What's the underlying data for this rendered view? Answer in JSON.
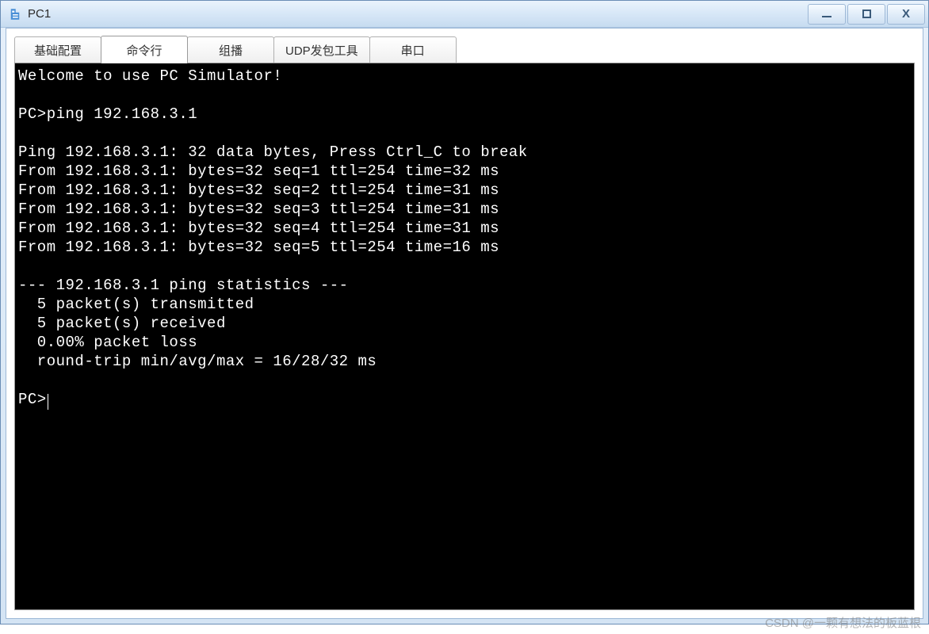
{
  "window": {
    "title": "PC1"
  },
  "tabs": [
    {
      "label": "基础配置",
      "active": false
    },
    {
      "label": "命令行",
      "active": true
    },
    {
      "label": "组播",
      "active": false
    },
    {
      "label": "UDP发包工具",
      "active": false
    },
    {
      "label": "串口",
      "active": false
    }
  ],
  "terminal": {
    "lines": [
      "Welcome to use PC Simulator!",
      "",
      "PC>ping 192.168.3.1",
      "",
      "Ping 192.168.3.1: 32 data bytes, Press Ctrl_C to break",
      "From 192.168.3.1: bytes=32 seq=1 ttl=254 time=32 ms",
      "From 192.168.3.1: bytes=32 seq=2 ttl=254 time=31 ms",
      "From 192.168.3.1: bytes=32 seq=3 ttl=254 time=31 ms",
      "From 192.168.3.1: bytes=32 seq=4 ttl=254 time=31 ms",
      "From 192.168.3.1: bytes=32 seq=5 ttl=254 time=16 ms",
      "",
      "--- 192.168.3.1 ping statistics ---",
      "  5 packet(s) transmitted",
      "  5 packet(s) received",
      "  0.00% packet loss",
      "  round-trip min/avg/max = 16/28/32 ms",
      "",
      "PC>"
    ],
    "prompt": "PC>"
  },
  "watermark": "CSDN @一颗有想法的板蓝根"
}
